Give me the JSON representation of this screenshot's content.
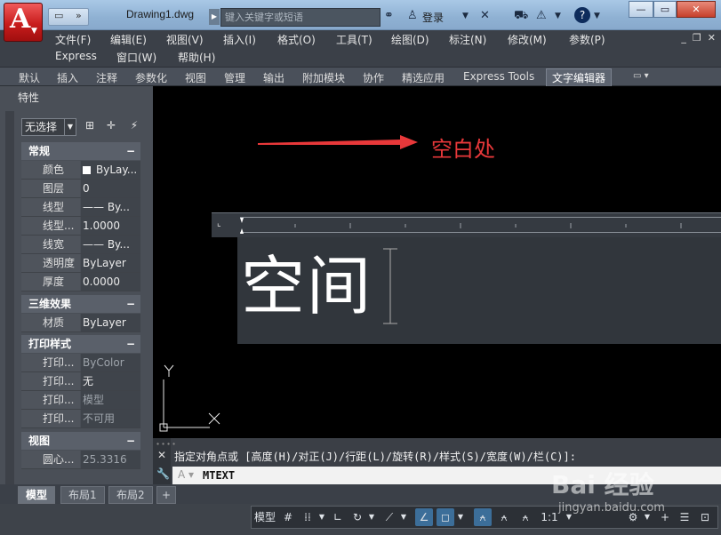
{
  "titlebar": {
    "document_title": "Drawing1.dwg",
    "search_placeholder": "键入关键字或短语",
    "login_label": "登录"
  },
  "menubar": {
    "items": [
      "文件(F)",
      "编辑(E)",
      "视图(V)",
      "插入(I)",
      "格式(O)",
      "工具(T)",
      "绘图(D)",
      "标注(N)",
      "修改(M)",
      "参数(P)",
      "Express",
      "窗口(W)",
      "帮助(H)"
    ]
  },
  "ribbon": {
    "tabs": [
      "默认",
      "插入",
      "注释",
      "参数化",
      "视图",
      "管理",
      "输出",
      "附加模块",
      "协作",
      "精选应用",
      "Express Tools",
      "文字编辑器"
    ],
    "active_tab": "文字编辑器"
  },
  "properties": {
    "title": "特性",
    "selection": "无选择",
    "sections": {
      "general": {
        "title": "常规",
        "rows": [
          {
            "key": "颜色",
            "value": "ByLay..."
          },
          {
            "key": "图层",
            "value": "0"
          },
          {
            "key": "线型",
            "value": "—— By..."
          },
          {
            "key": "线型...",
            "value": "1.0000"
          },
          {
            "key": "线宽",
            "value": "—— By..."
          },
          {
            "key": "透明度",
            "value": "ByLayer"
          },
          {
            "key": "厚度",
            "value": "0.0000"
          }
        ]
      },
      "3d": {
        "title": "三维效果",
        "rows": [
          {
            "key": "材质",
            "value": "ByLayer"
          }
        ]
      },
      "plot": {
        "title": "打印样式",
        "rows": [
          {
            "key": "打印...",
            "value": "ByColor"
          },
          {
            "key": "打印...",
            "value": "无"
          },
          {
            "key": "打印...",
            "value": "模型"
          },
          {
            "key": "打印...",
            "value": "不可用"
          }
        ]
      },
      "view": {
        "title": "视图",
        "rows": [
          {
            "key": "圆心...",
            "value": "25.3316"
          }
        ]
      }
    }
  },
  "canvas": {
    "annotation_top": "空白处",
    "mtext": "空间",
    "ucs_x": "X",
    "ucs_y": "Y",
    "annotation_color": "#e8383a"
  },
  "command": {
    "history": "指定对角点或 [高度(H)/对正(J)/行距(L)/旋转(R)/样式(S)/宽度(W)/栏(C)]:",
    "input": "MTEXT"
  },
  "layout_tabs": [
    "模型",
    "布局1",
    "布局2"
  ],
  "statusbar": {
    "model_label": "模型",
    "scale_label": "1:1"
  },
  "watermark": {
    "brand": "Bai 经验",
    "url": "jingyan.baidu.com"
  }
}
